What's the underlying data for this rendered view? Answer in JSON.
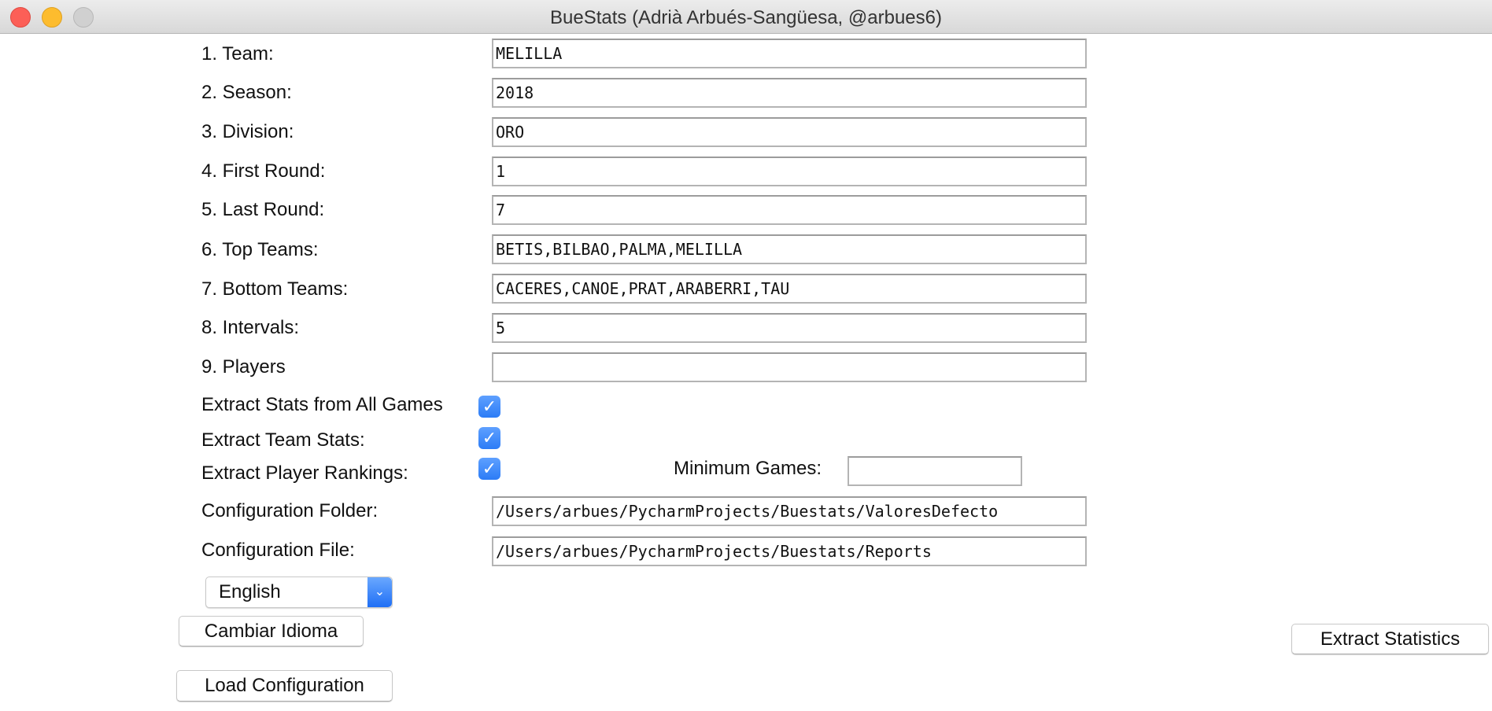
{
  "window": {
    "title": "BueStats (Adrià Arbués-Sangüesa, @arbues6)"
  },
  "fields": [
    {
      "label": "1. Team:",
      "value": "MELILLA"
    },
    {
      "label": "2. Season:",
      "value": "2018"
    },
    {
      "label": "3. Division:",
      "value": "ORO"
    },
    {
      "label": "4. First Round:",
      "value": "1"
    },
    {
      "label": "5. Last Round:",
      "value": "7"
    },
    {
      "label": "6. Top Teams:",
      "value": "BETIS,BILBAO,PALMA,MELILLA"
    },
    {
      "label": "7. Bottom Teams:",
      "value": "CACERES,CANOE,PRAT,ARABERRI,TAU"
    },
    {
      "label": "8. Intervals:",
      "value": "5"
    },
    {
      "label": "9. Players",
      "value": ""
    }
  ],
  "checkboxes": [
    {
      "label": "Extract Stats from All Games",
      "checked": true
    },
    {
      "label": "Extract Team Stats:",
      "checked": true
    },
    {
      "label": "Extract Player Rankings:",
      "checked": true
    }
  ],
  "minimum_games": {
    "label": "Minimum Games:",
    "value": ""
  },
  "config_folder": {
    "label": "Configuration Folder:",
    "value": "/Users/arbues/PycharmProjects/Buestats/ValoresDefecto"
  },
  "config_file": {
    "label": "Configuration File:",
    "value": "/Users/arbues/PycharmProjects/Buestats/Reports"
  },
  "language": {
    "selected": "English"
  },
  "buttons": {
    "change_language": "Cambiar Idioma",
    "load_config": "Load Configuration",
    "extract": "Extract Statistics"
  },
  "colors": {
    "accent": "#2c7cf6"
  }
}
